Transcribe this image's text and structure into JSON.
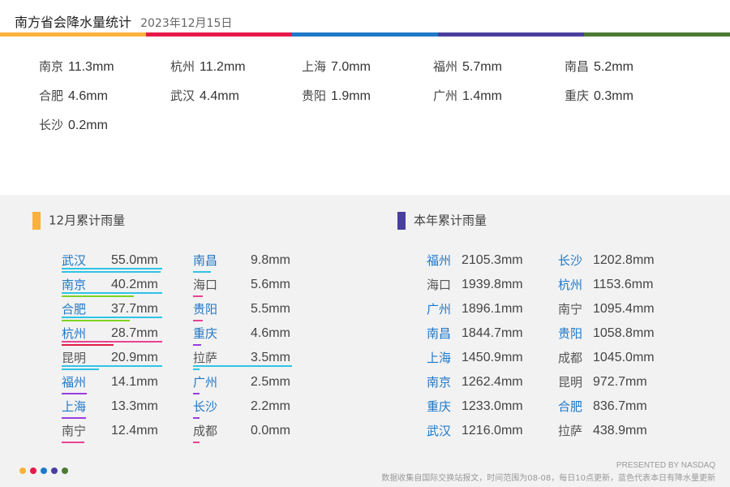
{
  "header": {
    "title": "南方省会降水量统计",
    "date": "2023年12月15日"
  },
  "colors": {
    "yellow": "#fbb13c",
    "red": "#e6194b",
    "blue": "#1f78c8",
    "indigo": "#4a3f9e",
    "green": "#4e7a36",
    "cyan": "#2ec4e6",
    "lime": "#7ed321",
    "pink": "#e84393",
    "violet": "#9b3de0",
    "blue_text": "#1f78c8",
    "gray_text": "#555555"
  },
  "today": [
    {
      "city": "南京",
      "value": "11.3mm"
    },
    {
      "city": "杭州",
      "value": "11.2mm"
    },
    {
      "city": "上海",
      "value": "7.0mm"
    },
    {
      "city": "福州",
      "value": "5.7mm"
    },
    {
      "city": "南昌",
      "value": "5.2mm"
    },
    {
      "city": "合肥",
      "value": "4.6mm"
    },
    {
      "city": "武汉",
      "value": "4.4mm"
    },
    {
      "city": "贵阳",
      "value": "1.9mm"
    },
    {
      "city": "广州",
      "value": "1.4mm"
    },
    {
      "city": "重庆",
      "value": "0.3mm"
    },
    {
      "city": "长沙",
      "value": "0.2mm"
    }
  ],
  "december": {
    "title": "12月累计雨量",
    "col1": [
      {
        "city": "武汉",
        "value": "55.0mm",
        "updated": true,
        "amount": 55.0
      },
      {
        "city": "南京",
        "value": "40.2mm",
        "updated": true,
        "amount": 40.2
      },
      {
        "city": "合肥",
        "value": "37.7mm",
        "updated": true,
        "amount": 37.7
      },
      {
        "city": "杭州",
        "value": "28.7mm",
        "updated": true,
        "amount": 28.7
      },
      {
        "city": "昆明",
        "value": "20.9mm",
        "updated": false,
        "amount": 20.9
      },
      {
        "city": "福州",
        "value": "14.1mm",
        "updated": true,
        "amount": 14.1
      },
      {
        "city": "上海",
        "value": "13.3mm",
        "updated": true,
        "amount": 13.3
      },
      {
        "city": "南宁",
        "value": "12.4mm",
        "updated": false,
        "amount": 12.4
      }
    ],
    "col2": [
      {
        "city": "南昌",
        "value": "9.8mm",
        "updated": true,
        "amount": 9.8
      },
      {
        "city": "海口",
        "value": "5.6mm",
        "updated": false,
        "amount": 5.6
      },
      {
        "city": "贵阳",
        "value": "5.5mm",
        "updated": true,
        "amount": 5.5
      },
      {
        "city": "重庆",
        "value": "4.6mm",
        "updated": true,
        "amount": 4.6
      },
      {
        "city": "拉萨",
        "value": "3.5mm",
        "updated": false,
        "amount": 3.5
      },
      {
        "city": "广州",
        "value": "2.5mm",
        "updated": true,
        "amount": 2.5
      },
      {
        "city": "长沙",
        "value": "2.2mm",
        "updated": true,
        "amount": 2.2
      },
      {
        "city": "成都",
        "value": "0.0mm",
        "updated": false,
        "amount": 0.0
      }
    ]
  },
  "year": {
    "title": "本年累计雨量",
    "col1": [
      {
        "city": "福州",
        "value": "2105.3mm",
        "updated": true
      },
      {
        "city": "海口",
        "value": "1939.8mm",
        "updated": false
      },
      {
        "city": "广州",
        "value": "1896.1mm",
        "updated": true
      },
      {
        "city": "南昌",
        "value": "1844.7mm",
        "updated": true
      },
      {
        "city": "上海",
        "value": "1450.9mm",
        "updated": true
      },
      {
        "city": "南京",
        "value": "1262.4mm",
        "updated": true
      },
      {
        "city": "重庆",
        "value": "1233.0mm",
        "updated": true
      },
      {
        "city": "武汉",
        "value": "1216.0mm",
        "updated": true
      }
    ],
    "col2": [
      {
        "city": "长沙",
        "value": "1202.8mm",
        "updated": true
      },
      {
        "city": "杭州",
        "value": "1153.6mm",
        "updated": true
      },
      {
        "city": "南宁",
        "value": "1095.4mm",
        "updated": false
      },
      {
        "city": "贵阳",
        "value": "1058.8mm",
        "updated": true
      },
      {
        "city": "成都",
        "value": "1045.0mm",
        "updated": false
      },
      {
        "city": "昆明",
        "value": "972.7mm",
        "updated": false
      },
      {
        "city": "合肥",
        "value": "836.7mm",
        "updated": true
      },
      {
        "city": "拉萨",
        "value": "438.9mm",
        "updated": false
      }
    ]
  },
  "footer": {
    "presented": "PRESENTED BY NASDAQ",
    "note": "数据收集自国际交换站报文，时间范围为08-08，每日10点更新，蓝色代表本日有降水量更新"
  }
}
